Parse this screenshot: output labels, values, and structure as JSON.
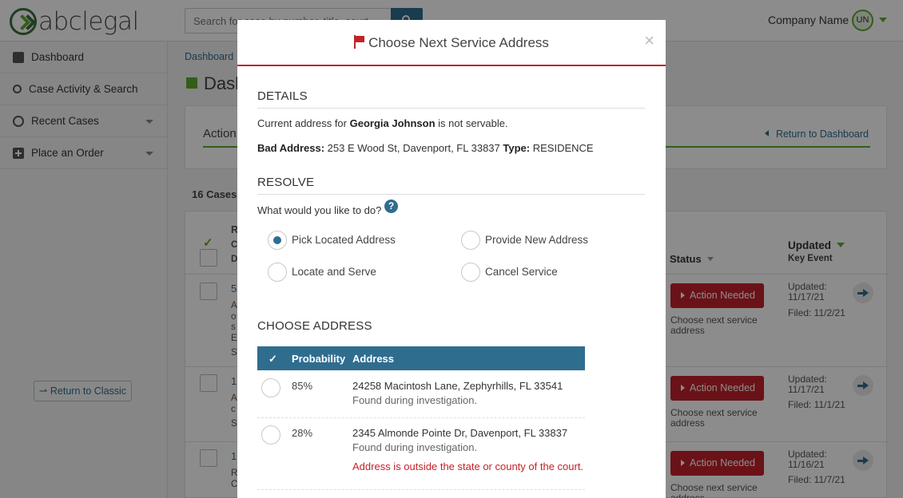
{
  "header": {
    "logo_text": "abclegal",
    "search_placeholder": "Search for case by number, title, court...",
    "company_name": "Company Name",
    "user_initials": "UN"
  },
  "sidebar": {
    "items": [
      {
        "label": "Dashboard",
        "icon": "dashboard-icon"
      },
      {
        "label": "Case Activity & Search",
        "icon": "search-icon"
      },
      {
        "label": "Recent Cases",
        "icon": "history-icon"
      },
      {
        "label": "Place an Order",
        "icon": "plus-square-icon"
      }
    ],
    "return_classic": "Return to Classic"
  },
  "main": {
    "breadcrumb": "Dashboard",
    "page_title": "Dash",
    "tab_label": "Action",
    "return_dashboard": "Return to Dashboard",
    "cases_count": "16 Cases",
    "columns": {
      "status": "Status",
      "updated": "Updated",
      "key_event": "Key Event"
    },
    "rows": [
      {
        "action_label": "Action Needed",
        "note": "Choose next service address",
        "updated": "Updated: 11/17/21",
        "filed": "Filed: 11/2/21"
      },
      {
        "action_label": "Action Needed",
        "note": "Choose next service address",
        "updated": "Updated: 11/17/21",
        "filed": "Filed: 11/1/21"
      },
      {
        "action_label": "Action Needed",
        "note": "Choose next service address",
        "updated": "Updated: 11/16/21",
        "filed": "Filed: 11/7/21"
      }
    ]
  },
  "modal": {
    "title": "Choose Next Service Address",
    "close_label": "×",
    "details_heading": "DETAILS",
    "current_prefix": "Current address for",
    "person_name": "Georgia Johnson",
    "current_suffix": "is not servable.",
    "bad_address_label": "Bad Address:",
    "bad_address_value": "253 E Wood St, Davenport, FL 33837",
    "type_label": "Type:",
    "type_value": "RESIDENCE",
    "resolve_heading": "RESOLVE",
    "question": "What would you like to do?",
    "help_label": "?",
    "options": [
      {
        "label": "Pick Located Address",
        "selected": true
      },
      {
        "label": "Provide New Address",
        "selected": false
      },
      {
        "label": "Locate and Serve",
        "selected": false
      },
      {
        "label": "Cancel Service",
        "selected": false
      }
    ],
    "choose_heading": "CHOOSE ADDRESS",
    "table": {
      "check_glyph": "✓",
      "col_probability": "Probability",
      "col_address": "Address",
      "rows": [
        {
          "probability": "85%",
          "address": "24258 Macintosh Lane, Zephyrhills, FL 33541",
          "note": "Found during investigation.",
          "warning": ""
        },
        {
          "probability": "28%",
          "address": "2345 Almonde Pointe Dr, Davenport, FL 33837",
          "note": "Found during investigation.",
          "warning": "Address is outside the state or county of the court."
        }
      ]
    }
  },
  "colors": {
    "accent_blue": "#2f6d8f",
    "brand_green": "#5cab2c",
    "alert_red": "#c2222a"
  }
}
